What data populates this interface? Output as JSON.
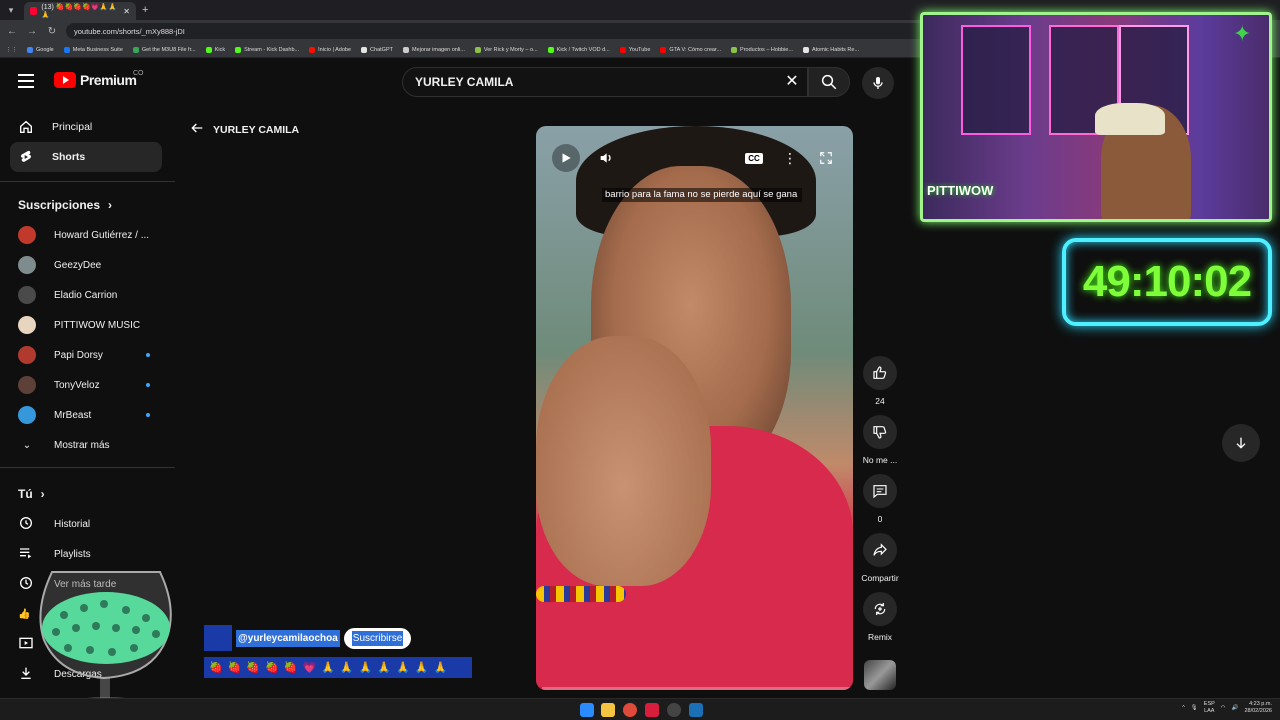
{
  "browser": {
    "tab_title": "(13) 🍓🍓🍓🍓💗🙏🙏🙏",
    "url": "youtube.com/shorts/_mXy888-jDI",
    "bookmarks": [
      {
        "label": "Google",
        "color": "#4285f4"
      },
      {
        "label": "Meta Business Suite",
        "color": "#1877f2"
      },
      {
        "label": "Get the M3U8 File fr...",
        "color": "#3aa657"
      },
      {
        "label": "Kick",
        "color": "#53fc18"
      },
      {
        "label": "Stream - Kick Dashb...",
        "color": "#53fc18"
      },
      {
        "label": "Inicio | Adobe",
        "color": "#fa0f00"
      },
      {
        "label": "ChatGPT",
        "color": "#e5e5e5"
      },
      {
        "label": "Mejorar imagen onli...",
        "color": "#cccccc"
      },
      {
        "label": "Ver Rick y Morty – o...",
        "color": "#8bc34a"
      },
      {
        "label": "Kick / Twitch VOD d...",
        "color": "#53fc18"
      },
      {
        "label": "YouTube",
        "color": "#ff0000"
      },
      {
        "label": "GTA V: Cómo crear...",
        "color": "#ff0000"
      },
      {
        "label": "Productos – Hobbie...",
        "color": "#8bc34a"
      },
      {
        "label": "Atomic Habits Re...",
        "color": "#e5e5e5"
      }
    ]
  },
  "header": {
    "logo_text": "Premium",
    "country_code": "CO",
    "search_value": "YURLEY CAMILA"
  },
  "sidebar": {
    "main": [
      {
        "label": "Principal"
      },
      {
        "label": "Shorts"
      }
    ],
    "subscriptions_title": "Suscripciones",
    "subscriptions": [
      {
        "label": "Howard Gutiérrez / ...",
        "color": "#c0392b",
        "new": false
      },
      {
        "label": "GeezyDee",
        "color": "#7f8c8d",
        "new": false
      },
      {
        "label": "Eladio Carrion",
        "color": "#4a4a4a",
        "new": false
      },
      {
        "label": "PITTIWOW MUSIC",
        "color": "#e8d5c0",
        "new": false
      },
      {
        "label": "Papi Dorsy",
        "color": "#b03a2e",
        "new": true
      },
      {
        "label": "TonyVeloz",
        "color": "#5d4037",
        "new": true
      },
      {
        "label": "MrBeast",
        "color": "#3498db",
        "new": true
      }
    ],
    "show_more": "Mostrar más",
    "you_title": "Tú",
    "you_items": [
      {
        "label": "Historial"
      },
      {
        "label": "Playlists"
      },
      {
        "label": "Ver más tarde"
      },
      {
        "label": "Descargas"
      }
    ]
  },
  "shorts": {
    "back_label": "YURLEY CAMILA",
    "caption": "barrio para la fama no se pierde aquí se gana",
    "progress_percent": 2,
    "channel_handle": "@yurleycamilaochoa",
    "subscribe_label": "Suscribirse",
    "title_emojis": [
      "🍓",
      "🍓",
      "🍓",
      "🍓",
      "🍓",
      "💗",
      "🙏",
      "🙏",
      "🙏",
      "🙏",
      "🙏",
      "🙏",
      "🙏"
    ],
    "actions": {
      "likes": "24",
      "dislike_label": "No me ...",
      "comments": "0",
      "share_label": "Compartir",
      "remix_label": "Remix"
    }
  },
  "overlay": {
    "streamer_logo": "PITTIWOW",
    "timer": "49:10:02"
  },
  "taskbar": {
    "lang_line1": "ESP",
    "lang_line2": "LAA",
    "time": "4:23 p.m.",
    "date": "28/02/2026"
  }
}
